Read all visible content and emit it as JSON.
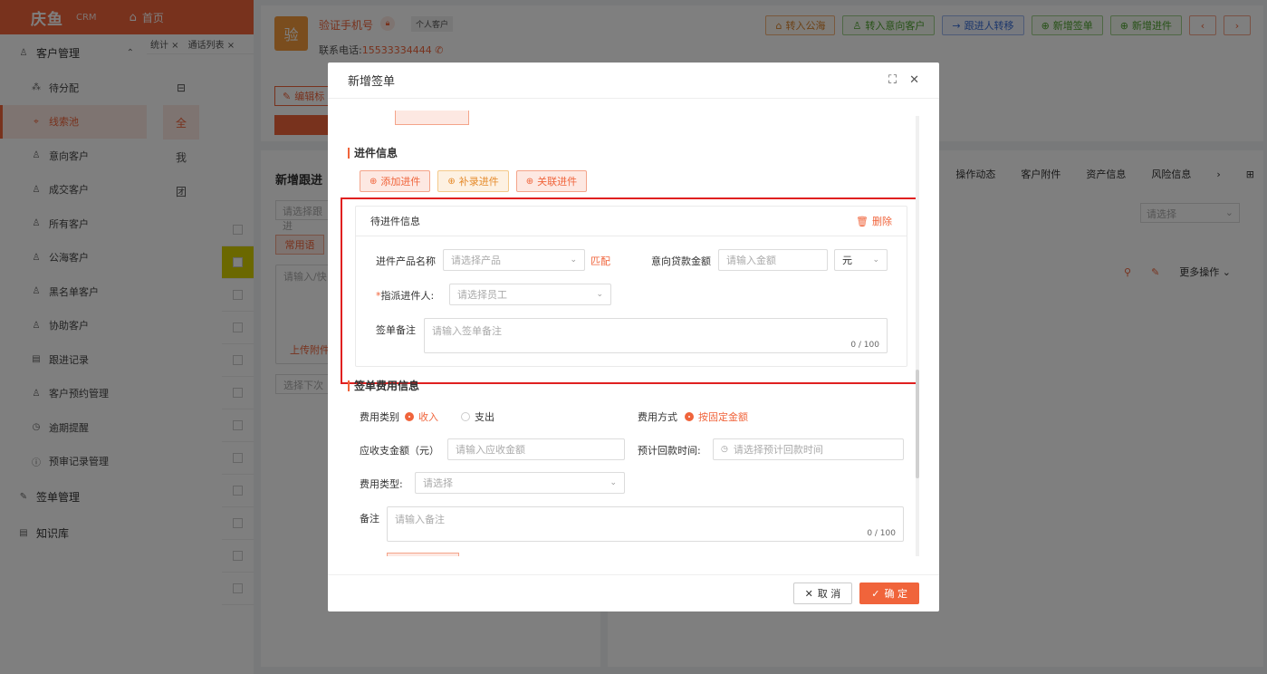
{
  "topbar": {
    "logo": "庆鱼",
    "logo_sub": "CRM",
    "home": "首页"
  },
  "open_tabs": [
    "统计 ×",
    "通话列表 ×"
  ],
  "sidebar": {
    "group1": "客户管理",
    "items": [
      {
        "label": "待分配"
      },
      {
        "label": "线索池"
      },
      {
        "label": "意向客户"
      },
      {
        "label": "成交客户"
      },
      {
        "label": "所有客户"
      },
      {
        "label": "公海客户"
      },
      {
        "label": "黑名单客户"
      },
      {
        "label": "协助客户"
      },
      {
        "label": "跟进记录"
      },
      {
        "label": "客户预约管理"
      },
      {
        "label": "逾期提醒"
      },
      {
        "label": "预审记录管理"
      }
    ],
    "group2": "签单管理",
    "group3": "知识库"
  },
  "subcol": [
    "全",
    "我",
    "团"
  ],
  "customer": {
    "avatar": "验",
    "name": "验证手机号",
    "type": "个人客户",
    "phone_label": "联系电话:",
    "phone": "15533334444",
    "edit_tag": "编辑标"
  },
  "head_buttons": {
    "to_public": "转入公海",
    "to_intent": "转入意向客户",
    "transfer": "跟进人转移",
    "new_sign": "新增签单",
    "new_entry": "新增进件"
  },
  "left_panel": {
    "title": "新增跟进",
    "select_ph": "请选择跟进",
    "tag": "常用语",
    "textarea_ph": "请输入/快",
    "upload": "上传附件",
    "next_ph": "选择下次"
  },
  "right_panel": {
    "tabs": [
      "操作动态",
      "客户附件",
      "资产信息",
      "风险信息"
    ],
    "select_ph": "请选择",
    "more": "更多操作"
  },
  "dialog": {
    "title": "新增签单",
    "section_entry": "进件信息",
    "add_entry": "添加进件",
    "supplement_entry": "补录进件",
    "link_entry": "关联进件",
    "card_title": "待进件信息",
    "delete": "删除",
    "product_label": "进件产品名称",
    "product_ph": "请选择产品",
    "match": "匹配",
    "loan_label": "意向贷款金额",
    "loan_ph": "请输入金额",
    "unit": "元",
    "assignee_label": "指派进件人:",
    "assignee_ph": "请选择员工",
    "remark_label": "签单备注",
    "remark_ph": "请输入签单备注",
    "remark_count": "0 / 100",
    "section_fee": "签单费用信息",
    "fee_category_label": "费用类别",
    "fee_income": "收入",
    "fee_expense": "支出",
    "fee_method_label": "费用方式",
    "fee_method_fixed": "按固定金额",
    "receivable_label": "应收支金额（元）",
    "receivable_ph": "请输入应收金额",
    "payback_label": "预计回款时间:",
    "payback_ph": "请选择预计回款时间",
    "fee_type_label": "费用类型:",
    "fee_type_ph": "请选择",
    "note_label": "备注",
    "note_ph": "请输入备注",
    "note_count": "0 / 100",
    "cancel": "取 消",
    "confirm": "确 定"
  },
  "colors": {
    "accent": "#f0643b",
    "highlight": "#e02020"
  }
}
